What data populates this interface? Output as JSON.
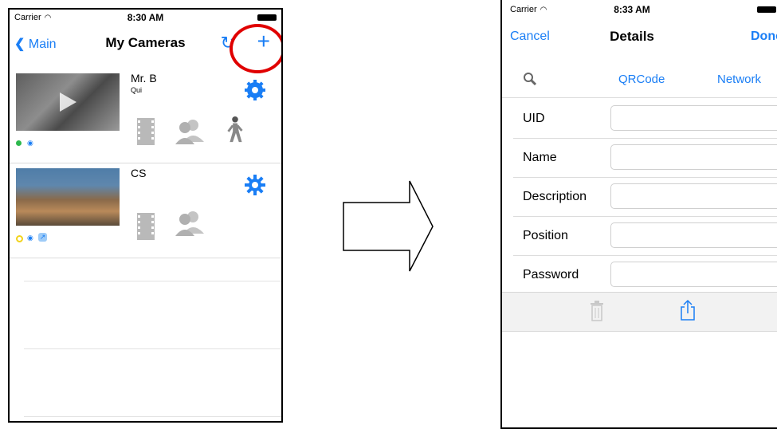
{
  "left_phone": {
    "status": {
      "carrier": "Carrier",
      "time": "8:30 AM"
    },
    "nav": {
      "back_label": "Main",
      "title": "My Cameras",
      "refresh_icon": "refresh-icon",
      "add_icon": "plus-icon"
    },
    "cameras": [
      {
        "name": "Mr. B",
        "subtitle": "Qui",
        "status_color": "#2db84d"
      },
      {
        "name": "CS",
        "subtitle": "",
        "status_color": "#f2d31b"
      }
    ]
  },
  "right_phone": {
    "status": {
      "carrier": "Carrier",
      "time": "8:33 AM"
    },
    "nav": {
      "cancel_label": "Cancel",
      "title": "Details",
      "done_label": "Done"
    },
    "tabs": {
      "search_icon": "search-icon",
      "qrcode_label": "QRCode",
      "network_label": "Network"
    },
    "fields": [
      {
        "label": "UID",
        "value": "",
        "placeholder": ""
      },
      {
        "label": "Name",
        "value": "",
        "placeholder": ""
      },
      {
        "label": "Description",
        "value": "",
        "placeholder": ""
      },
      {
        "label": "Position",
        "value": "",
        "placeholder": ""
      },
      {
        "label": "Password",
        "value": "",
        "placeholder": ""
      }
    ],
    "toolbar": {
      "delete_icon": "trash-icon",
      "share_icon": "share-icon"
    }
  },
  "colors": {
    "accent": "#1a7ef5",
    "highlight": "#e00000"
  }
}
